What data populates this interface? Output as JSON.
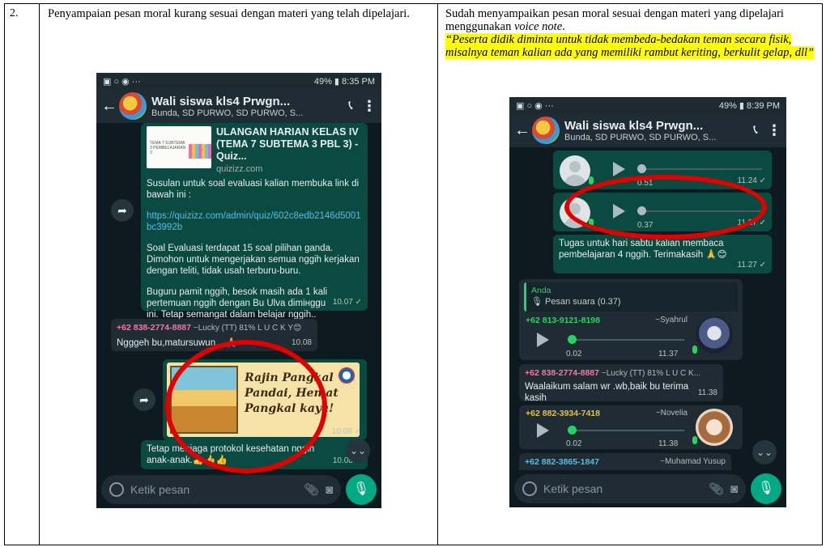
{
  "doc": {
    "row_number": "2.",
    "left_text": "Penyampaian pesan moral kurang sesuai dengan materi yang telah dipelajari.",
    "right_text_1": "Sudah menyampaikan pesan moral sesuai dengan materi yang dipelajari menggunakan ",
    "right_text_voice": "voice note",
    "right_text_end": ".",
    "right_quote": "“Peserta didik diminta untuk tidak membeda-bedakan teman secara fisik, misalnya teman kalian ada yang memiliki rambut keriting, berkulit gelap, dll”"
  },
  "phone1": {
    "status_right": "49% ▮ 8:35 PM",
    "status_left": "▣ ○ ◉ ···",
    "group_name": "Wali siswa kls4 Prwgn...",
    "members": "Bunda, SD PURWO, SD PURWO, S...",
    "quiz_thumb_text": "TEMA 7 SUBTEMA 3 PEMBELAJARAN 3",
    "quiz_title": "ULANGAN HARIAN KELAS IV (TEMA 7 SUBTEMA 3 PBL 3) - Quiz...",
    "quiz_domain": "quizizz.com",
    "msg_intro": "Susulan untuk soal evaluasi kalian membuka link di bawah ini :",
    "msg_link": "https://quizizz.com/admin/quiz/602c8edb2146d5001bc3992b",
    "msg_eval": "Soal Evaluasi terdapat 15 soal pilihan ganda. Dimohon untuk mengerjakan semua nggih kerjakan dengan teliti, tidak usah terburu-buru.",
    "msg_pamit": "Buguru pamit nggih, besok masih ada 1 kali pertemuan nggih dengan Bu Ulva dimінggu ini. Tetap semangat dalam belajar nggih..",
    "time_1": "10.07 ✓",
    "reply_sender": "+62 838-2774-8887",
    "reply_meta": "~Lucky (TT) 81% L U C K Y😊",
    "reply_text": "Ngggeh bu,matursuwun... 🙏",
    "time_2": "10.08",
    "poster_text": "Rajin Pangkal Pandai, Hemat Pangkal kaya!",
    "time_3": "10.08 ✓",
    "msg_protokol": "Tetap menjaga protokol kesehatan nggih anak-anak.👍👍👍",
    "time_4": "10.08 ✓",
    "input_placeholder": "Ketik pesan"
  },
  "phone2": {
    "status_right": "49% ▮ 8:39 PM",
    "status_left": "▣ ○ ◉ ···",
    "group_name": "Wali siswa kls4 Prwgn...",
    "members": "Bunda, SD PURWO, SD PURWO, S...",
    "vn1_dur": "0.51",
    "vn1_time": "11.24 ✓",
    "vn2_dur": "0.37",
    "vn2_time": "11.27 ✓",
    "msg_tugas": "Tugas untuk hari sabtu kalian membaca pembelajaran 4 nggih. Terimakasih 🙏😊",
    "time_tugas": "11.27 ✓",
    "quote_name": "Anda",
    "quote_text": "🎙 Pesan suara (0.37)",
    "syahrul_num": "+62 813-9121-8198",
    "syahrul_name": "~Syahrul",
    "syahrul_dur": "0.02",
    "syahrul_time": "11.37",
    "lucky_num": "+62 838-2774-8887",
    "lucky_meta": "~Lucky (TT) 81% L U C K...",
    "lucky_text": "Waalaikum salam wr .wb,baik bu terima kasih",
    "lucky_time": "11.38",
    "novelia_num": "+62 882-3934-7418",
    "novelia_name": "~Novelia",
    "novelia_dur": "0.02",
    "novelia_time": "11.38",
    "yusup_num": "+62 882-3865-1847",
    "yusup_name": "~Muhamad Yusup",
    "input_placeholder": "Ketik pesan"
  },
  "colors": {
    "annotation_red": "#e00000",
    "highlight_yellow": "#ffff00",
    "wa_outgoing": "#0a4a40",
    "wa_accent": "#00a884"
  }
}
